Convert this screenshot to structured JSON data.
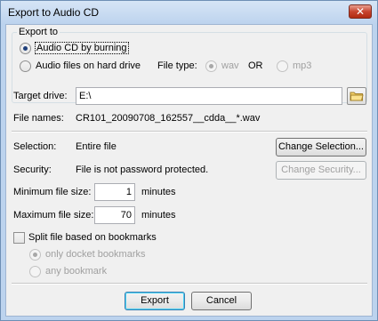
{
  "window": {
    "title": "Export to Audio CD",
    "close_label": "✕"
  },
  "export_to": {
    "group_label": "Export to",
    "option_cd": "Audio CD by burning",
    "option_files": "Audio files on hard drive",
    "file_type_label": "File type:",
    "wav_label": "wav",
    "or_label": "OR",
    "mp3_label": "mp3"
  },
  "target": {
    "drive_label": "Target drive:",
    "drive_value": "E:\\",
    "folder_icon": "folder-icon",
    "filenames_label": "File names:",
    "filenames_value": "CR101_20090708_162557__cdda__*.wav"
  },
  "selection": {
    "label": "Selection:",
    "value": "Entire file",
    "button": "Change Selection..."
  },
  "security": {
    "label": "Security:",
    "value": "File is not password protected.",
    "button": "Change Security..."
  },
  "sizes": {
    "min_label": "Minimum file size:",
    "min_value": "1",
    "max_label": "Maximum file size:",
    "max_value": "70",
    "unit": "minutes"
  },
  "split": {
    "label": "Split file based on bookmarks",
    "option_docket": "only docket bookmarks",
    "option_any": "any bookmark"
  },
  "footer": {
    "export": "Export",
    "cancel": "Cancel"
  },
  "colors": {
    "title_bar": "#bcd3ee",
    "close_red": "#c7452f",
    "dialog_bg": "#f0f0f0"
  }
}
